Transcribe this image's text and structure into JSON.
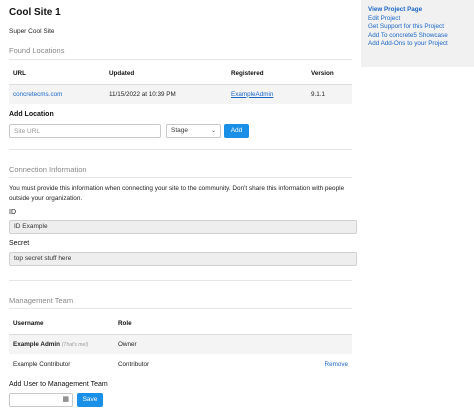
{
  "site": {
    "title": "Cool Site 1",
    "subtitle": "Super Cool Site"
  },
  "found_locations": {
    "heading": "Found Locations",
    "columns": [
      "URL",
      "Updated",
      "Registered",
      "Version"
    ],
    "rows": [
      {
        "url": "concretecms.com",
        "updated": "11/15/2022 at 10:39 PM",
        "registered": "ExampleAdmin",
        "version": "9.1.1"
      }
    ]
  },
  "add_location": {
    "label": "Add Location",
    "url_placeholder": "Site URL",
    "stage_value": "Stage",
    "add_label": "Add"
  },
  "connection": {
    "heading": "Connection Information",
    "description": "You must provide this information when connecting your site to the community. Don't share this information with people outside your organization.",
    "id_label": "ID",
    "id_value": "ID Example",
    "secret_label": "Secret",
    "secret_value": "top secret stuff here"
  },
  "team": {
    "heading": "Management Team",
    "columns": [
      "Username",
      "Role"
    ],
    "rows": [
      {
        "username": "Example Admin",
        "note": "(That's me!)",
        "role": "Owner",
        "action": ""
      },
      {
        "username": "Example Contributor",
        "note": "",
        "role": "Contributor",
        "action": "Remove"
      }
    ]
  },
  "add_user": {
    "label": "Add User to Management Team",
    "save_label": "Save",
    "picker_icon": "user-picker-icon"
  },
  "sidebar": {
    "links": [
      "View Project Page",
      "Edit Project",
      "Get Support for this Project",
      "Add To concrete5 Showcase",
      "Add Add-Ons to your Project"
    ]
  },
  "colors": {
    "accent": "#1a8fe8",
    "link": "#1a66c8"
  }
}
